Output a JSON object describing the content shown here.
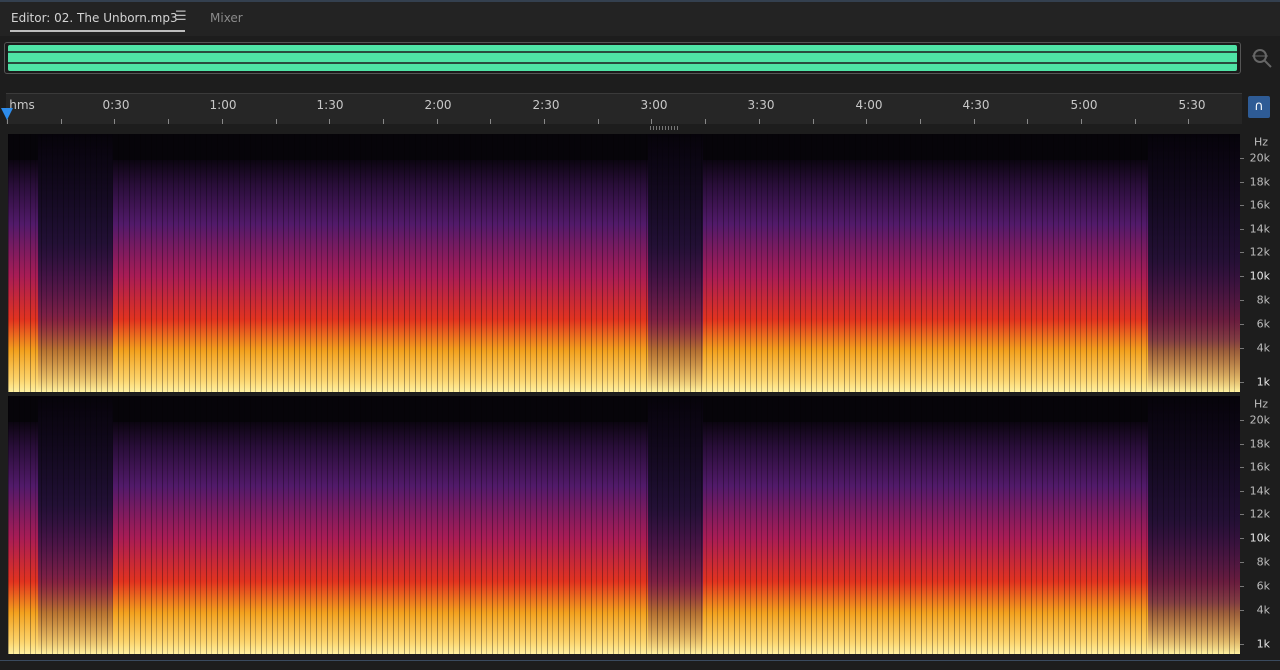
{
  "tabs": {
    "editor_label": "Editor: 02. The Unborn.mp3",
    "menu_icon": "hamburger-menu-icon",
    "mixer_label": "Mixer"
  },
  "overview": {
    "wave_color": "#4fe3a6",
    "zoom_icon": "zoom-navigator-icon"
  },
  "ruler": {
    "labels": [
      "hms",
      "0:30",
      "1:00",
      "1:30",
      "2:00",
      "2:30",
      "3:00",
      "3:30",
      "4:00",
      "4:30",
      "5:00",
      "5:30"
    ],
    "playhead_color": "#2d8ceb",
    "loop_icon": "loop-playback-icon"
  },
  "channels": [
    {
      "unit": "Hz",
      "freq_labels": [
        "20k",
        "18k",
        "16k",
        "14k",
        "12k",
        "10k",
        "8k",
        "6k",
        "4k",
        "1k"
      ]
    },
    {
      "unit": "Hz",
      "freq_labels": [
        "20k",
        "18k",
        "16k",
        "14k",
        "12k",
        "10k",
        "8k",
        "6k",
        "4k",
        "1k"
      ]
    }
  ],
  "colors": {
    "background": "#1d1d1d",
    "spectrum_low": "#fff1a0",
    "spectrum_mid": "#e2331f",
    "spectrum_high": "#521a6a"
  }
}
